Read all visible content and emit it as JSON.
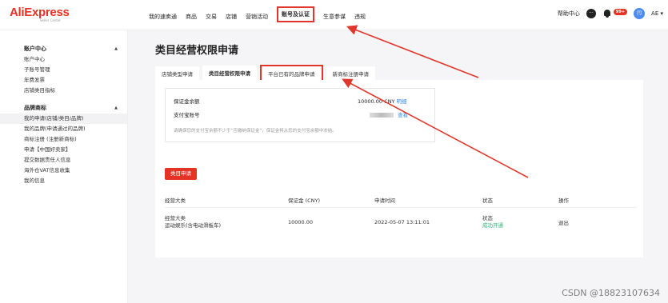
{
  "brand": {
    "name": "AliExpress",
    "subtitle": "Seller Center"
  },
  "nav": {
    "items": [
      "我的速卖通",
      "商品",
      "交易",
      "店铺",
      "营销活动",
      "账号及认证",
      "生意参谋",
      "违规"
    ],
    "active_index": 5
  },
  "top_right": {
    "help": "帮助中心",
    "badge": "99+",
    "user": "AE ▾",
    "avatar": "闫"
  },
  "sidebar": {
    "groups": [
      {
        "title": "账户中心",
        "items": [
          "账户中心",
          "子账号管理",
          "年费发票",
          "店铺类目指标"
        ]
      },
      {
        "title": "品牌商标",
        "items": [
          "我的申请(店铺/类目/品牌)",
          "我的品牌(申请通过的品牌)",
          "商标注册 (注册新商标)",
          "申请【中国好卖家】",
          "提交数据责任人信息",
          "海外仓VAT信息收集",
          "我的信息"
        ]
      }
    ],
    "current_item": "我的申请(店铺/类目/品牌)"
  },
  "page": {
    "title": "类目经营权限申请",
    "tabs": [
      "店铺类型申请",
      "类目经营权限申请",
      "平台已有的品牌申请",
      "新商标注册申请"
    ],
    "selected_tab": 1,
    "highlighted_tab": 2
  },
  "deposit": {
    "label_amount": "保证金余额",
    "amount": "10000.00 CNY",
    "amount_link": "明细",
    "label_alipay": "支付宝账号",
    "alipay_link": "查看",
    "note": "请确保您的支付宝余额不少于“应缴纳保证金”，保证金将从您的支付宝余额中冻结。"
  },
  "apply_button": "类目申请",
  "table": {
    "headers": [
      "经营大类",
      "保证金 (CNY)",
      "申请时间",
      "状态",
      "操作"
    ],
    "rows": [
      {
        "category_label": "经营大类",
        "category": "运动娱乐(含电动滑板车)",
        "deposit": "10000.00",
        "time": "2022-05-07 13:11:01",
        "status_label": "状态",
        "status": "成功开通",
        "action": "退出"
      }
    ]
  },
  "colors": {
    "brand_red": "#e43225",
    "link_blue": "#3a8ee6",
    "success_green": "#2bb673"
  },
  "watermark": "CSDN @18823107634"
}
